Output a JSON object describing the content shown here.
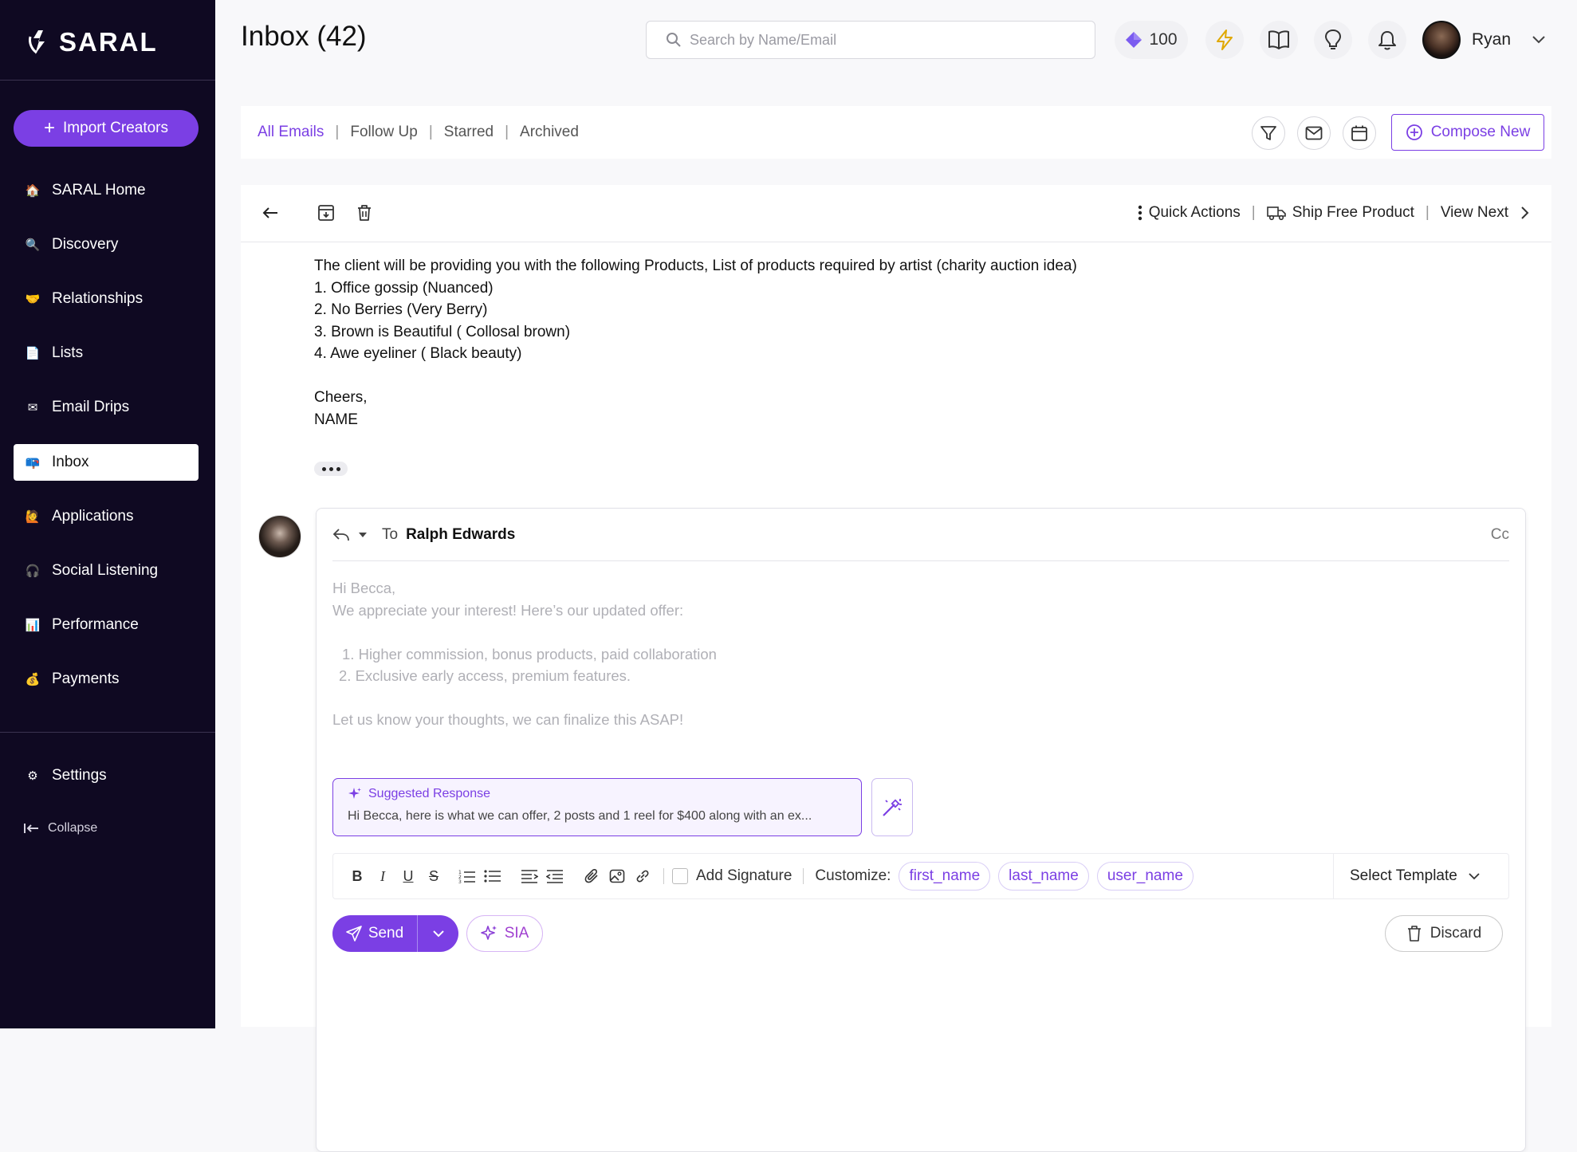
{
  "app": {
    "name": "SARAL"
  },
  "sidebar": {
    "import_label": "Import Creators",
    "items": [
      {
        "label": "SARAL Home",
        "icon": "🏠"
      },
      {
        "label": "Discovery",
        "icon": "🔍"
      },
      {
        "label": "Relationships",
        "icon": "🤝"
      },
      {
        "label": "Lists",
        "icon": "📄"
      },
      {
        "label": "Email Drips",
        "icon": "✉"
      },
      {
        "label": "Inbox",
        "icon": "📪"
      },
      {
        "label": "Applications",
        "icon": "🙋"
      },
      {
        "label": "Social Listening",
        "icon": "🎧"
      },
      {
        "label": "Performance",
        "icon": "📊"
      },
      {
        "label": "Payments",
        "icon": "💰"
      }
    ],
    "settings_label": "Settings",
    "settings_icon": "⚙",
    "collapse_label": "Collapse"
  },
  "header": {
    "title": "Inbox (42)",
    "search_placeholder": "Search by Name/Email",
    "credits": "100",
    "user_name": "Ryan"
  },
  "tabs": {
    "all": "All Emails",
    "follow_up": "Follow Up",
    "starred": "Starred",
    "archived": "Archived",
    "compose": "Compose New"
  },
  "toolbar": {
    "quick_actions": "Quick Actions",
    "ship": "Ship Free Product",
    "view_next": "View Next"
  },
  "email_body": {
    "lines": [
      "The client will be providing you with the following Products, List of products required by artist (charity auction idea)",
      "1. Office gossip (Nuanced)",
      "2. No Berries (Very Berry)",
      "3. Brown is Beautiful ( Collosal brown)",
      "4. Awe eyeliner ( Black beauty)",
      "",
      "Cheers,",
      "NAME"
    ]
  },
  "reply": {
    "to_label": "To",
    "to_name": "Ralph Edwards",
    "cc": "Cc",
    "draft": {
      "greeting": "Hi Becca,",
      "intro": "We appreciate your interest! Here’s our updated offer:",
      "items": [
        "Higher commission, bonus products, paid collaboration",
        "Exclusive early access, premium features."
      ],
      "closing": "Let us know your thoughts, we can finalize this ASAP!"
    },
    "suggest_title": "Suggested Response",
    "suggest_text": "Hi Becca, here is what we can offer, 2 posts and 1 reel for $400 along with an ex...",
    "add_signature": "Add Signature",
    "customize": "Customize:",
    "chips": [
      "first_name",
      "last_name",
      "user_name"
    ],
    "select_template": "Select Template",
    "send": "Send",
    "sia": "SIA",
    "discard": "Discard"
  },
  "colors": {
    "accent": "#7b3fe4",
    "sidebar_bg": "#0f0922"
  }
}
